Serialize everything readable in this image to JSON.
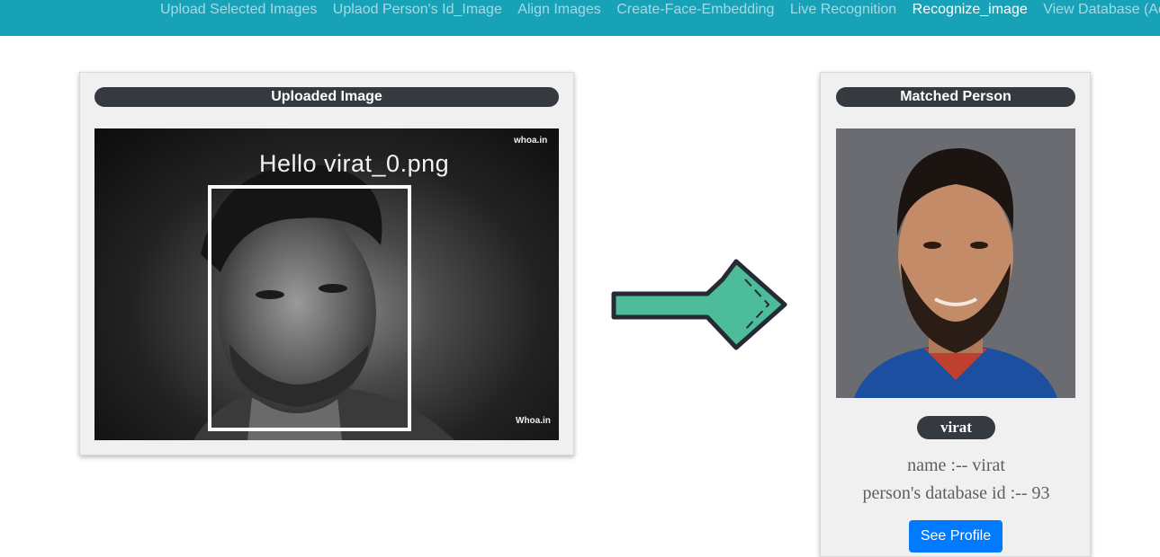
{
  "nav": {
    "links": [
      "Upload Selected Images",
      "Uplaod Person's Id_Image",
      "Align Images",
      "Create-Face-Embedding",
      "Live Recognition",
      "Recognize_image",
      "View Database (Ad"
    ],
    "active_index": 5
  },
  "uploaded_card": {
    "title": "Uploaded Image",
    "overlay_text": "Hello virat_0.png",
    "watermark_top": "whoa.in",
    "watermark_bottom": "Whoa.in"
  },
  "matched_card": {
    "title": "Matched Person",
    "name_badge": "virat",
    "name_line": "name :-- virat",
    "id_line": "person's database id :-- 93",
    "button_label": "See Profile"
  },
  "colors": {
    "navbar": "#17a2b8",
    "pill": "#343a40",
    "button": "#007bff",
    "arrow_fill": "#4dbc9a",
    "arrow_outline": "#252a34"
  },
  "icons": {
    "arrow": "right-arrow-icon"
  }
}
